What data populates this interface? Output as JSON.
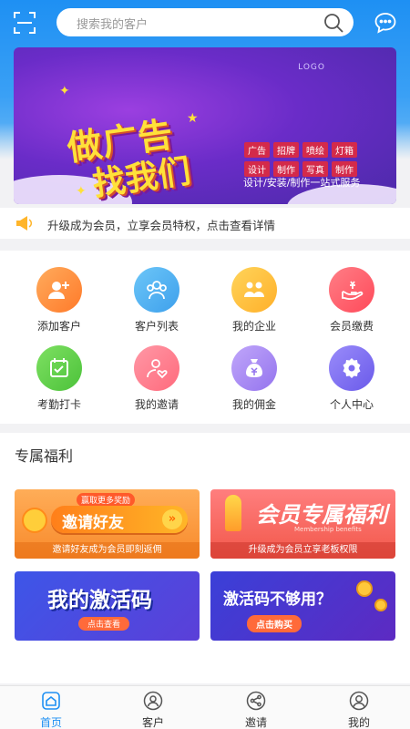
{
  "header": {
    "search_placeholder": "搜索我的客户",
    "left_icon": "scan-icon",
    "right_icon": "chat-bubble-icon"
  },
  "banner": {
    "logo": "LOGO",
    "headline_1": "做广告",
    "headline_2": "找我们",
    "tags_row1": [
      "广告",
      "招牌",
      "喷绘",
      "灯箱"
    ],
    "tags_row2": [
      "设计",
      "制作",
      "写真",
      "制作"
    ],
    "slogan": "设计/安装/制作一站式服务"
  },
  "notice": {
    "icon": "megaphone-icon",
    "text": "升级成为会员，立享会员特权，点击查看详情"
  },
  "menu": [
    {
      "label": "添加客户",
      "icon": "add-user-icon",
      "color": "#ff8a3d"
    },
    {
      "label": "客户列表",
      "icon": "customers-icon",
      "color": "#4fb3f0"
    },
    {
      "label": "我的企业",
      "icon": "company-icon",
      "color": "#ffc23a"
    },
    {
      "label": "会员缴费",
      "icon": "payment-icon",
      "color": "#ff5d6a"
    },
    {
      "label": "考勤打卡",
      "icon": "calendar-check-icon",
      "color": "#5ccf4a"
    },
    {
      "label": "我的邀请",
      "icon": "invite-icon",
      "color": "#ff7a8a"
    },
    {
      "label": "我的佣金",
      "icon": "money-bag-icon",
      "color": "#a88af0"
    },
    {
      "label": "个人中心",
      "icon": "gear-icon",
      "color": "#7e6cf2"
    }
  ],
  "welfare": {
    "title": "专属福利",
    "card1": {
      "badge": "赢取更多奖励",
      "headline": "邀请好友",
      "caption": "邀请好友成为会员即刻返佣"
    },
    "card2": {
      "headline": "会员专属福利",
      "small": "Membership benefits",
      "caption": "升级成为会员立享老板权限"
    },
    "card3": {
      "headline": "我的激活码",
      "button": "点击查看"
    },
    "card4": {
      "headline": "激活码不够用？",
      "button": "点击购买"
    }
  },
  "tabs": [
    {
      "label": "首页",
      "icon": "home-icon",
      "active": true
    },
    {
      "label": "客户",
      "icon": "customer-icon",
      "active": false
    },
    {
      "label": "邀请",
      "icon": "share-icon",
      "active": false
    },
    {
      "label": "我的",
      "icon": "profile-icon",
      "active": false
    }
  ],
  "colors": {
    "primary": "#1e90f3",
    "page_bg": "#f2f2f4"
  }
}
